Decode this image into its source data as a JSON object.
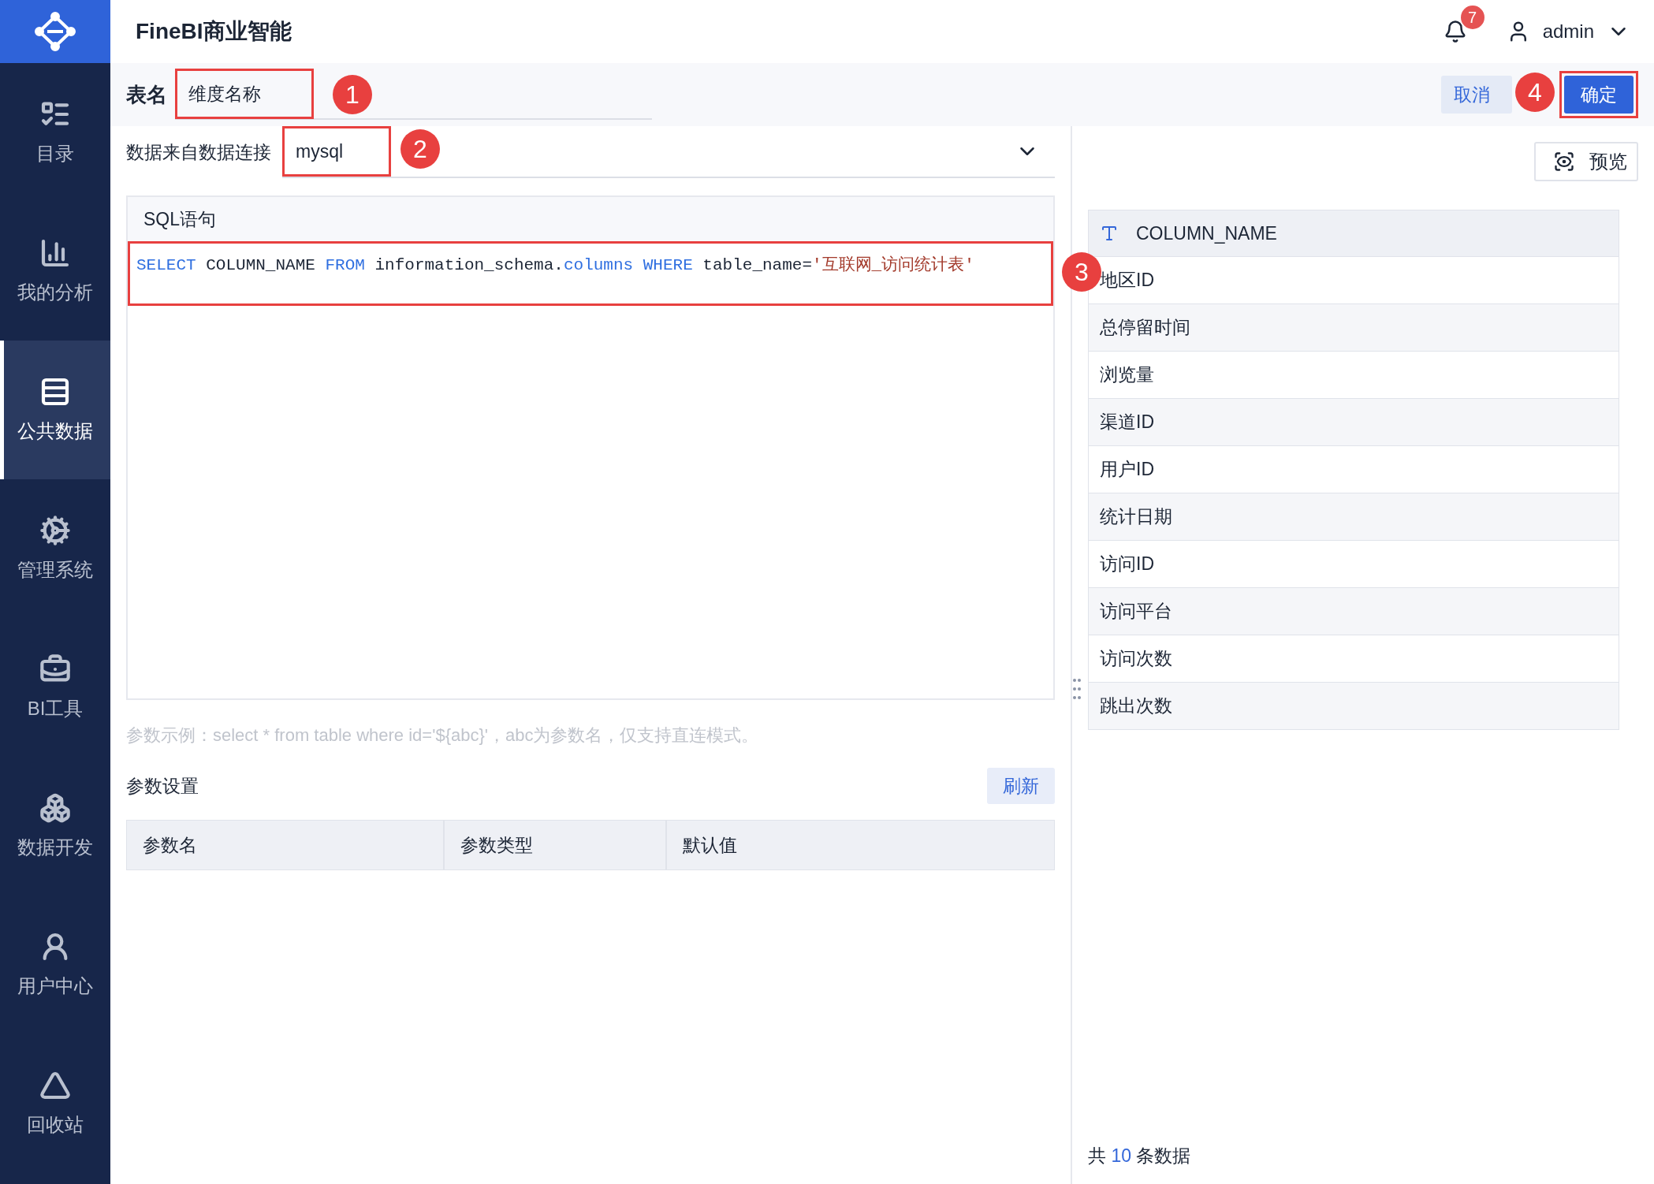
{
  "app": {
    "title": "FineBI商业智能",
    "notifications": "7",
    "user": "admin"
  },
  "sidebar": {
    "items": [
      {
        "label": "目录",
        "selected": false
      },
      {
        "label": "我的分析",
        "selected": false
      },
      {
        "label": "公共数据",
        "selected": true
      },
      {
        "label": "管理系统",
        "selected": false
      },
      {
        "label": "BI工具",
        "selected": false
      },
      {
        "label": "数据开发",
        "selected": false
      },
      {
        "label": "用户中心",
        "selected": false
      },
      {
        "label": "回收站",
        "selected": false
      }
    ]
  },
  "table_name": {
    "label": "表名",
    "value": "维度名称",
    "callout": "1"
  },
  "actions": {
    "cancel": "取消",
    "confirm": "确定",
    "callout": "4"
  },
  "connection": {
    "label": "数据来自数据连接",
    "value": "mysql",
    "callout": "2"
  },
  "sql": {
    "title": "SQL语句",
    "callout": "3",
    "tokens": [
      {
        "kind": "keyword",
        "text": "SELECT"
      },
      {
        "kind": "plain",
        "text": " COLUMN_NAME "
      },
      {
        "kind": "keyword",
        "text": "FROM"
      },
      {
        "kind": "plain",
        "text": " information_schema."
      },
      {
        "kind": "keyword",
        "text": "columns"
      },
      {
        "kind": "keyword",
        "text": " WHERE"
      },
      {
        "kind": "plain",
        "text": " table_name="
      },
      {
        "kind": "string",
        "text": "'互联网_访问统计表'"
      }
    ]
  },
  "hint": "参数示例：select * from table where id='${abc}'，abc为参数名，仅支持直连模式。",
  "params": {
    "title": "参数设置",
    "refresh": "刷新",
    "columns": [
      "参数名",
      "参数类型",
      "默认值"
    ]
  },
  "preview": {
    "button": "预览",
    "column": "COLUMN_NAME",
    "rows": [
      "地区ID",
      "总停留时间",
      "浏览量",
      "渠道ID",
      "用户ID",
      "统计日期",
      "访问ID",
      "访问平台",
      "访问次数",
      "跳出次数"
    ],
    "footer_prefix": "共",
    "count": "10",
    "footer_suffix": "条数据"
  }
}
